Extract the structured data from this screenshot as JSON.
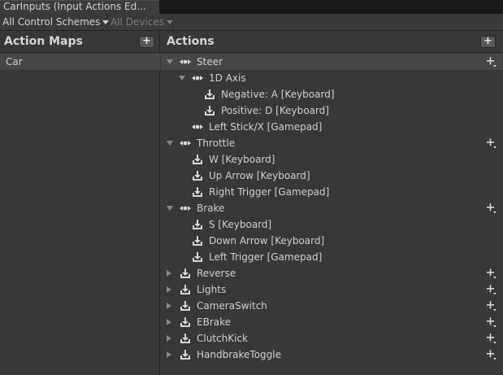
{
  "window": {
    "tab_title": "CarInputs (Input Actions Ed..."
  },
  "toolbar": {
    "control_schemes": "All Control Schemes",
    "devices": "All Devices"
  },
  "action_maps": {
    "title": "Action Maps",
    "add_label": "+",
    "items": [
      {
        "label": "Car"
      }
    ]
  },
  "actions": {
    "title": "Actions",
    "add_label": "+",
    "rows": [
      {
        "label": "Steer",
        "level": 0,
        "icon": "axis-icon",
        "toggle": "down",
        "add": true,
        "selected": true
      },
      {
        "label": "1D Axis",
        "level": 1,
        "icon": "axis-icon",
        "toggle": "down",
        "add": false
      },
      {
        "label": "Negative: A [Keyboard]",
        "level": 3,
        "icon": "binding-icon",
        "toggle": "",
        "add": false
      },
      {
        "label": "Positive: D [Keyboard]",
        "level": 3,
        "icon": "binding-icon",
        "toggle": "",
        "add": false
      },
      {
        "label": "Left Stick/X [Gamepad]",
        "level": 2,
        "icon": "axis-icon",
        "toggle": "",
        "add": false
      },
      {
        "label": "Throttle",
        "level": 0,
        "icon": "axis-icon",
        "toggle": "down",
        "add": true
      },
      {
        "label": "W [Keyboard]",
        "level": 2,
        "icon": "binding-icon",
        "toggle": "",
        "add": false
      },
      {
        "label": "Up Arrow [Keyboard]",
        "level": 2,
        "icon": "binding-icon",
        "toggle": "",
        "add": false
      },
      {
        "label": "Right Trigger [Gamepad]",
        "level": 2,
        "icon": "binding-icon",
        "toggle": "",
        "add": false
      },
      {
        "label": "Brake",
        "level": 0,
        "icon": "axis-icon",
        "toggle": "down",
        "add": true
      },
      {
        "label": "S [Keyboard]",
        "level": 2,
        "icon": "binding-icon",
        "toggle": "",
        "add": false
      },
      {
        "label": "Down Arrow [Keyboard]",
        "level": 2,
        "icon": "binding-icon",
        "toggle": "",
        "add": false
      },
      {
        "label": "Left Trigger [Gamepad]",
        "level": 2,
        "icon": "binding-icon",
        "toggle": "",
        "add": false
      },
      {
        "label": "Reverse",
        "level": 0,
        "icon": "button-icon",
        "toggle": "right",
        "add": true
      },
      {
        "label": "Lights",
        "level": 0,
        "icon": "button-icon",
        "toggle": "right",
        "add": true
      },
      {
        "label": "CameraSwitch",
        "level": 0,
        "icon": "button-icon",
        "toggle": "right",
        "add": true
      },
      {
        "label": "EBrake",
        "level": 0,
        "icon": "button-icon",
        "toggle": "right",
        "add": true
      },
      {
        "label": "ClutchKick",
        "level": 0,
        "icon": "button-icon",
        "toggle": "right",
        "add": true
      },
      {
        "label": "HandbrakeToggle",
        "level": 0,
        "icon": "button-icon",
        "toggle": "right",
        "add": true
      }
    ]
  },
  "colors": {
    "background": "#383838",
    "selected_row": "#474747",
    "text": "#cfcfcf"
  }
}
